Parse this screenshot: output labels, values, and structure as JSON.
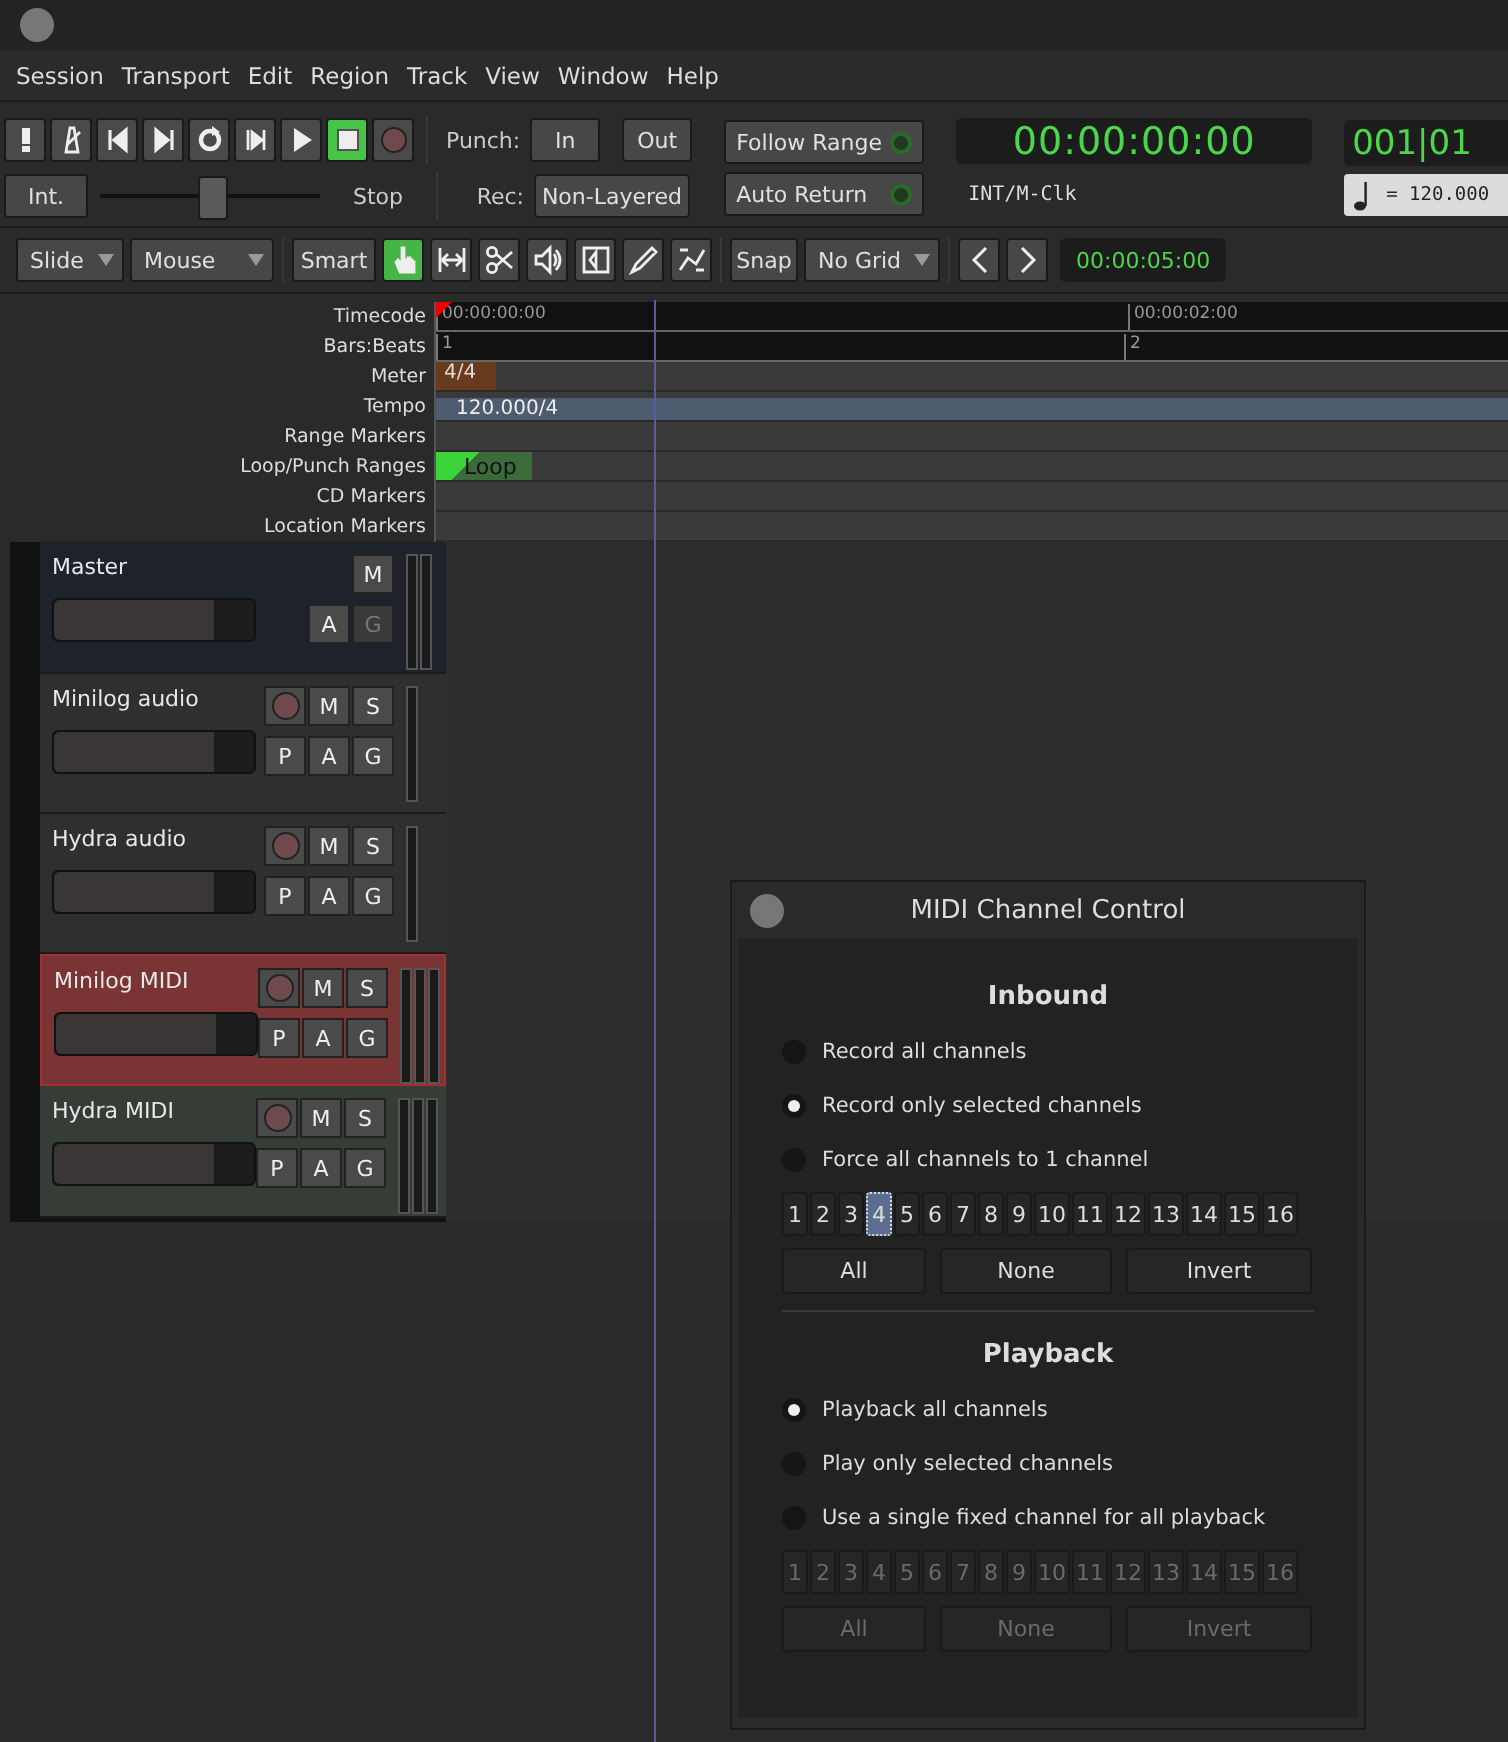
{
  "menu": [
    "Session",
    "Transport",
    "Edit",
    "Region",
    "Track",
    "View",
    "Window",
    "Help"
  ],
  "transport": {
    "buttons": [
      {
        "kind": "panic",
        "active": false
      },
      {
        "kind": "metronome",
        "active": false
      },
      {
        "kind": "start",
        "active": false
      },
      {
        "kind": "end",
        "active": false
      },
      {
        "kind": "loop",
        "active": false
      },
      {
        "kind": "range",
        "active": false
      },
      {
        "kind": "play",
        "active": false
      },
      {
        "kind": "stop",
        "active": true
      },
      {
        "kind": "record",
        "active": false
      }
    ],
    "punch_label": "Punch:",
    "punch_in": "In",
    "punch_out": "Out",
    "sync": "Int.",
    "shuttle": {
      "level": 0.5
    },
    "shuttle_label": "Stop",
    "rec_label": "Rec:",
    "rec_mode": "Non-Layered",
    "follow_range": "Follow Range",
    "auto_return": "Auto Return",
    "clock": "00:00:00:00",
    "clock_source": "INT/M-Clk",
    "bbt": "001|01",
    "tempo": "= 120.000"
  },
  "edit_toolbar": {
    "edit_mode": "Slide",
    "edit_point": "Mouse",
    "smart": "Smart",
    "tools": [
      {
        "kind": "grab",
        "selected": true
      },
      {
        "kind": "range",
        "selected": false
      },
      {
        "kind": "cut",
        "selected": false
      },
      {
        "kind": "audition",
        "selected": false
      },
      {
        "kind": "stretch",
        "selected": false
      },
      {
        "kind": "draw",
        "selected": false
      },
      {
        "kind": "content",
        "selected": false
      }
    ],
    "snap": "Snap",
    "grid": "No Grid",
    "nudge_clock": "00:00:05:00"
  },
  "rulers": {
    "labels": [
      "Timecode",
      "Bars:Beats",
      "Meter",
      "Tempo",
      "Range Markers",
      "Loop/Punch Ranges",
      "CD Markers",
      "Location Markers"
    ],
    "timecode_ticks": [
      "00:00:00:00",
      "00:00:02:00"
    ],
    "bars": [
      "1",
      "2"
    ],
    "meter": "4/4",
    "tempo": "120.000/4",
    "loop": "Loop"
  },
  "tracks": [
    {
      "name": "Master",
      "kind": "master",
      "selected": false,
      "rec": false,
      "top": [
        "M"
      ],
      "bottom": [
        {
          "label": "A",
          "disabled": false
        },
        {
          "label": "G",
          "disabled": true
        }
      ],
      "fader": {
        "level": 0.8
      }
    },
    {
      "name": "Minilog audio",
      "kind": "audio",
      "selected": false,
      "rec": true,
      "top": [
        "M",
        "S"
      ],
      "bottom": [
        {
          "label": "P",
          "disabled": false
        },
        {
          "label": "A",
          "disabled": false
        },
        {
          "label": "G",
          "disabled": false
        }
      ],
      "fader": {
        "level": 0.8
      }
    },
    {
      "name": "Hydra audio",
      "kind": "audio",
      "selected": false,
      "rec": true,
      "top": [
        "M",
        "S"
      ],
      "bottom": [
        {
          "label": "P",
          "disabled": false
        },
        {
          "label": "A",
          "disabled": false
        },
        {
          "label": "G",
          "disabled": false
        }
      ],
      "fader": {
        "level": 0.8
      }
    },
    {
      "name": "Minilog MIDI",
      "kind": "midi",
      "selected": true,
      "rec": true,
      "top": [
        "M",
        "S"
      ],
      "bottom": [
        {
          "label": "P",
          "disabled": false
        },
        {
          "label": "A",
          "disabled": false
        },
        {
          "label": "G",
          "disabled": false
        }
      ],
      "fader": {
        "level": 0.8
      }
    },
    {
      "name": "Hydra MIDI",
      "kind": "midi",
      "selected": false,
      "rec": true,
      "top": [
        "M",
        "S"
      ],
      "bottom": [
        {
          "label": "P",
          "disabled": false
        },
        {
          "label": "A",
          "disabled": false
        },
        {
          "label": "G",
          "disabled": false
        }
      ],
      "fader": {
        "level": 0.8
      }
    }
  ],
  "dialog": {
    "title": "MIDI Channel Control",
    "sections": [
      {
        "heading": "Inbound",
        "options": [
          {
            "label": "Record all channels",
            "selected": false
          },
          {
            "label": "Record only selected channels",
            "selected": true
          },
          {
            "label": "Force all channels to 1 channel",
            "selected": false
          }
        ],
        "disabled": false,
        "channels": [
          {
            "label": "1",
            "selected": false
          },
          {
            "label": "2",
            "selected": false
          },
          {
            "label": "3",
            "selected": false
          },
          {
            "label": "4",
            "selected": true
          },
          {
            "label": "5",
            "selected": false
          },
          {
            "label": "6",
            "selected": false
          },
          {
            "label": "7",
            "selected": false
          },
          {
            "label": "8",
            "selected": false
          },
          {
            "label": "9",
            "selected": false
          },
          {
            "label": "10",
            "selected": false
          },
          {
            "label": "11",
            "selected": false
          },
          {
            "label": "12",
            "selected": false
          },
          {
            "label": "13",
            "selected": false
          },
          {
            "label": "14",
            "selected": false
          },
          {
            "label": "15",
            "selected": false
          },
          {
            "label": "16",
            "selected": false
          }
        ],
        "buttons": [
          "All",
          "None",
          "Invert"
        ]
      },
      {
        "heading": "Playback",
        "options": [
          {
            "label": "Playback all channels",
            "selected": true
          },
          {
            "label": "Play only selected channels",
            "selected": false
          },
          {
            "label": "Use a single fixed channel for all playback",
            "selected": false
          }
        ],
        "disabled": true,
        "channels": [
          {
            "label": "1",
            "selected": false
          },
          {
            "label": "2",
            "selected": false
          },
          {
            "label": "3",
            "selected": false
          },
          {
            "label": "4",
            "selected": false
          },
          {
            "label": "5",
            "selected": false
          },
          {
            "label": "6",
            "selected": false
          },
          {
            "label": "7",
            "selected": false
          },
          {
            "label": "8",
            "selected": false
          },
          {
            "label": "9",
            "selected": false
          },
          {
            "label": "10",
            "selected": false
          },
          {
            "label": "11",
            "selected": false
          },
          {
            "label": "12",
            "selected": false
          },
          {
            "label": "13",
            "selected": false
          },
          {
            "label": "14",
            "selected": false
          },
          {
            "label": "15",
            "selected": false
          },
          {
            "label": "16",
            "selected": false
          }
        ],
        "buttons": [
          "All",
          "None",
          "Invert"
        ]
      }
    ]
  }
}
